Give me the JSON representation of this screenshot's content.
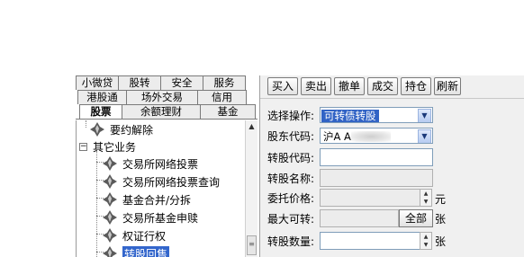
{
  "tabs": {
    "row1": [
      "小微贷",
      "股转",
      "安全",
      "服务"
    ],
    "row2": [
      "港股通",
      "场外交易",
      "信用"
    ],
    "row3": [
      "股票",
      "余额理财",
      "基金"
    ],
    "active": "股票"
  },
  "tree": {
    "items": [
      {
        "label": "要约解除",
        "kind": "leaf"
      },
      {
        "label": "其它业务",
        "kind": "folder",
        "toggle": "−"
      },
      {
        "label": "交易所网络投票",
        "kind": "leaf"
      },
      {
        "label": "交易所网络投票查询",
        "kind": "leaf"
      },
      {
        "label": "基金合并/分拆",
        "kind": "leaf"
      },
      {
        "label": "交易所基金申赎",
        "kind": "leaf"
      },
      {
        "label": "权证行权",
        "kind": "leaf"
      },
      {
        "label": "转股回售",
        "kind": "leaf",
        "selected": true
      }
    ]
  },
  "toolbar": {
    "buttons": [
      "买入",
      "卖出",
      "撤单",
      "成交",
      "持仓",
      "刷新"
    ]
  },
  "form": {
    "operation_label": "选择操作:",
    "operation_value": "可转债转股",
    "account_label": "股东代码:",
    "account_value": "沪A A2",
    "convert_code_label": "转股代码:",
    "convert_code_value": "",
    "convert_name_label": "转股名称:",
    "convert_name_value": "",
    "price_label": "委托价格:",
    "price_value": "",
    "price_unit": "元",
    "max_label": "最大可转:",
    "max_value": "",
    "all_button": "全部",
    "max_unit": "张",
    "qty_label": "转股数量:",
    "qty_value": "",
    "qty_unit": "张"
  },
  "colors": {
    "selection": "#3163c5",
    "panel_bg": "#f0f0f0",
    "field_border": "#7f9db9"
  },
  "icons": {
    "tree_leaf": "diamond-arrows-icon",
    "dropdown": "chevron-down-icon",
    "spin": "spin-arrows-icon"
  }
}
